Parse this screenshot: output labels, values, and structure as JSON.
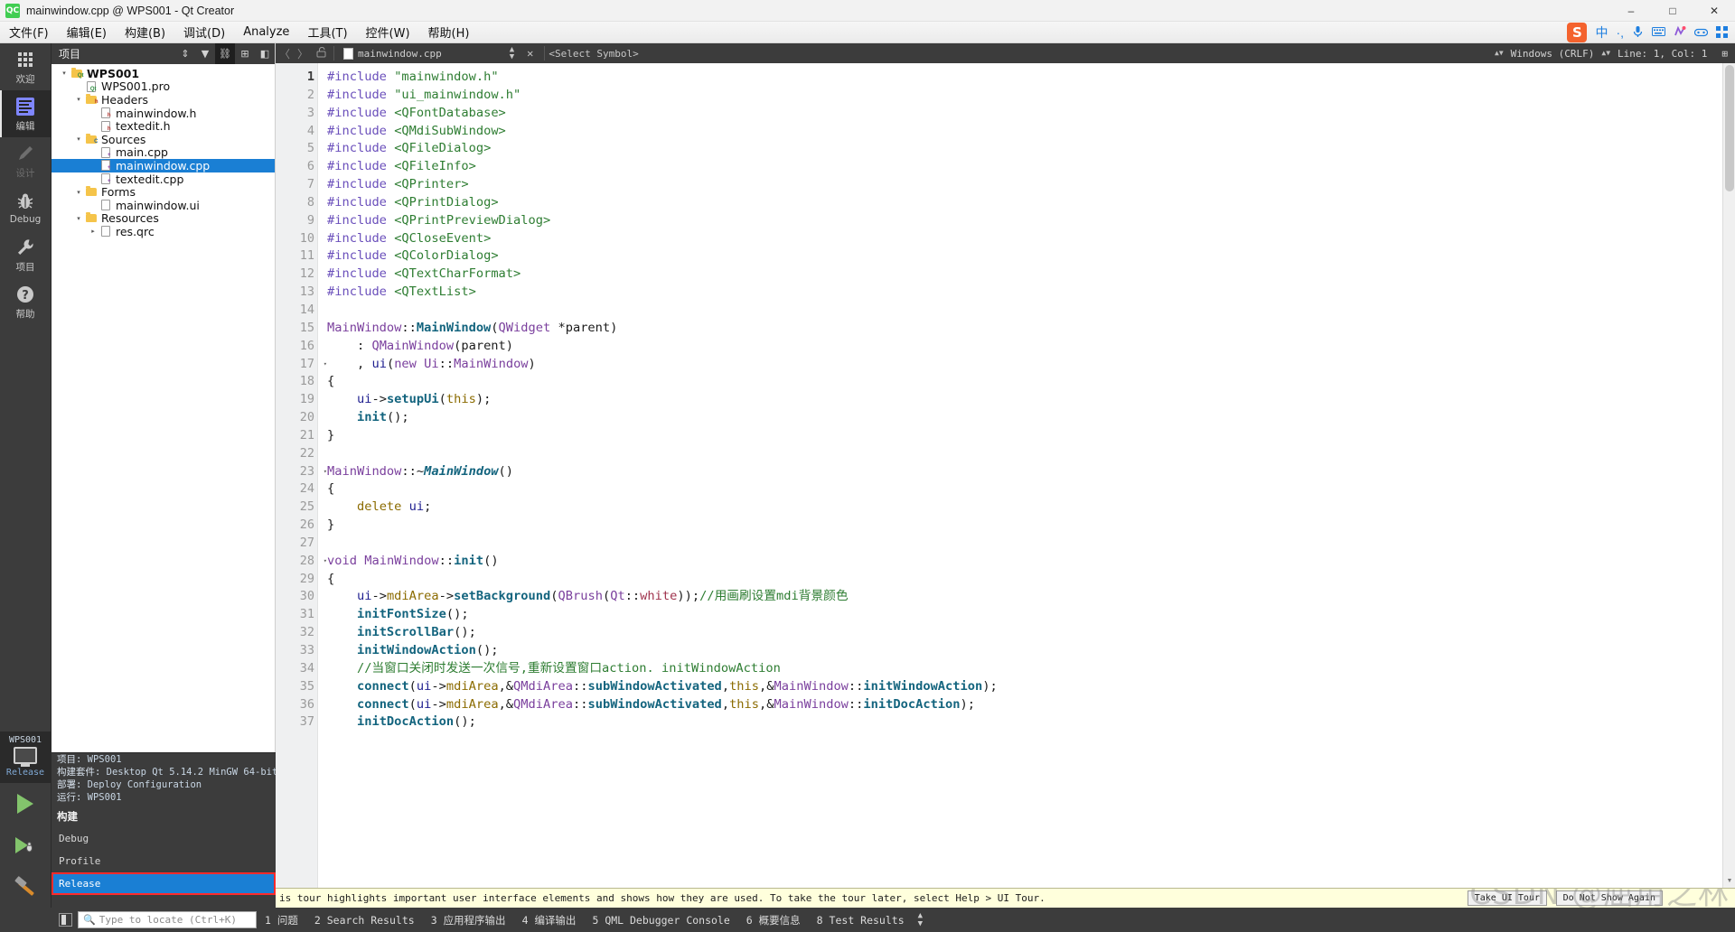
{
  "window": {
    "title": "mainwindow.cpp @ WPS001 - Qt Creator",
    "logo_text": "QC",
    "minimize": "–",
    "maximize": "□",
    "close": "✕"
  },
  "menubar": {
    "items": [
      {
        "label": "文件(F)",
        "name": "menu-file"
      },
      {
        "label": "编辑(E)",
        "name": "menu-edit"
      },
      {
        "label": "构建(B)",
        "name": "menu-build"
      },
      {
        "label": "调试(D)",
        "name": "menu-debug"
      },
      {
        "label": "Analyze",
        "name": "menu-analyze"
      },
      {
        "label": "工具(T)",
        "name": "menu-tools"
      },
      {
        "label": "控件(W)",
        "name": "menu-window"
      },
      {
        "label": "帮助(H)",
        "name": "menu-help"
      }
    ]
  },
  "ime_toolbar": {
    "logo": "S",
    "icons": [
      "中",
      "·,",
      "🎤",
      "⌨",
      "🎩",
      "🎮",
      "⊞"
    ]
  },
  "modebar": {
    "items": [
      {
        "label": "欢迎",
        "icon": "grid-icon",
        "state": "normal"
      },
      {
        "label": "编辑",
        "icon": "edit-icon",
        "state": "active"
      },
      {
        "label": "设计",
        "icon": "pencil-icon",
        "state": "disabled"
      },
      {
        "label": "Debug",
        "icon": "bug-icon",
        "state": "normal"
      },
      {
        "label": "项目",
        "icon": "wrench-icon",
        "state": "normal"
      },
      {
        "label": "帮助",
        "icon": "help-icon",
        "state": "normal"
      }
    ],
    "kit": {
      "project": "WPS001",
      "config": "Release"
    },
    "run_label": "run",
    "debug_label": "debug",
    "build_label": "build"
  },
  "sidebar": {
    "header": {
      "title": "项目",
      "tools": [
        "⇕",
        "▼",
        "⛓",
        "⊞",
        "◧"
      ]
    },
    "tree": [
      {
        "depth": 0,
        "label": "WPS001",
        "icon": "folder-qt",
        "arrow": "▾",
        "bold": true,
        "selected": false
      },
      {
        "depth": 1,
        "label": "WPS001.pro",
        "icon": "file-pro",
        "arrow": "",
        "bold": false,
        "selected": false
      },
      {
        "depth": 1,
        "label": "Headers",
        "icon": "folder-h",
        "arrow": "▾",
        "bold": false,
        "selected": false
      },
      {
        "depth": 2,
        "label": "mainwindow.h",
        "icon": "file-h",
        "arrow": "",
        "bold": false,
        "selected": false
      },
      {
        "depth": 2,
        "label": "textedit.h",
        "icon": "file-h",
        "arrow": "",
        "bold": false,
        "selected": false
      },
      {
        "depth": 1,
        "label": "Sources",
        "icon": "folder-cpp",
        "arrow": "▾",
        "bold": false,
        "selected": false
      },
      {
        "depth": 2,
        "label": "main.cpp",
        "icon": "file-cpp",
        "arrow": "",
        "bold": false,
        "selected": false
      },
      {
        "depth": 2,
        "label": "mainwindow.cpp",
        "icon": "file-cpp",
        "arrow": "",
        "bold": false,
        "selected": true
      },
      {
        "depth": 2,
        "label": "textedit.cpp",
        "icon": "file-cpp",
        "arrow": "",
        "bold": false,
        "selected": false
      },
      {
        "depth": 1,
        "label": "Forms",
        "icon": "folder-ui",
        "arrow": "▾",
        "bold": false,
        "selected": false
      },
      {
        "depth": 2,
        "label": "mainwindow.ui",
        "icon": "file-ui",
        "arrow": "",
        "bold": false,
        "selected": false
      },
      {
        "depth": 1,
        "label": "Resources",
        "icon": "folder-res",
        "arrow": "▾",
        "bold": false,
        "selected": false
      },
      {
        "depth": 2,
        "label": "res.qrc",
        "icon": "file-qrc",
        "arrow": "▸",
        "bold": false,
        "selected": false
      }
    ]
  },
  "build_popup": {
    "info": [
      {
        "key": "项目:",
        "value": "WPS001"
      },
      {
        "key": "构建套件:",
        "value": "Desktop Qt 5.14.2 MinGW 64-bit"
      },
      {
        "key": "部署:",
        "value": "Deploy Configuration"
      },
      {
        "key": "运行:",
        "value": "WPS001"
      }
    ],
    "section": "构建",
    "options": [
      {
        "label": "Debug",
        "selected": false
      },
      {
        "label": "Profile",
        "selected": false
      },
      {
        "label": "Release",
        "selected": true
      }
    ],
    "highlight_color": "#ff2b2b",
    "selection_color": "#1a7fd4"
  },
  "editor_toolbar": {
    "back": "〈",
    "forward": "〉",
    "lock_icon": "🔓",
    "filename": "mainwindow.cpp",
    "close_label": "✕",
    "symbol_selector": "<Select Symbol>",
    "line_ending": "Windows (CRLF)",
    "cursor": "Line: 1, Col: 1",
    "split_label": "⊞"
  },
  "code": {
    "first_line": 1,
    "lines": [
      {
        "n": 1,
        "fold": "",
        "tokens": [
          [
            "t-pre",
            "#include"
          ],
          [
            "t-plain",
            " "
          ],
          [
            "t-str",
            "\"mainwindow.h\""
          ]
        ]
      },
      {
        "n": 2,
        "fold": "",
        "tokens": [
          [
            "t-pre",
            "#include"
          ],
          [
            "t-plain",
            " "
          ],
          [
            "t-str",
            "\"ui_mainwindow.h\""
          ]
        ]
      },
      {
        "n": 3,
        "fold": "",
        "tokens": [
          [
            "t-pre",
            "#include"
          ],
          [
            "t-plain",
            " "
          ],
          [
            "t-inc",
            "<QFontDatabase>"
          ]
        ]
      },
      {
        "n": 4,
        "fold": "",
        "tokens": [
          [
            "t-pre",
            "#include"
          ],
          [
            "t-plain",
            " "
          ],
          [
            "t-inc",
            "<QMdiSubWindow>"
          ]
        ]
      },
      {
        "n": 5,
        "fold": "",
        "tokens": [
          [
            "t-pre",
            "#include"
          ],
          [
            "t-plain",
            " "
          ],
          [
            "t-inc",
            "<QFileDialog>"
          ]
        ]
      },
      {
        "n": 6,
        "fold": "",
        "tokens": [
          [
            "t-pre",
            "#include"
          ],
          [
            "t-plain",
            " "
          ],
          [
            "t-inc",
            "<QFileInfo>"
          ]
        ]
      },
      {
        "n": 7,
        "fold": "",
        "tokens": [
          [
            "t-pre",
            "#include"
          ],
          [
            "t-plain",
            " "
          ],
          [
            "t-inc",
            "<QPrinter>"
          ]
        ]
      },
      {
        "n": 8,
        "fold": "",
        "tokens": [
          [
            "t-pre",
            "#include"
          ],
          [
            "t-plain",
            " "
          ],
          [
            "t-inc",
            "<QPrintDialog>"
          ]
        ]
      },
      {
        "n": 9,
        "fold": "",
        "tokens": [
          [
            "t-pre",
            "#include"
          ],
          [
            "t-plain",
            " "
          ],
          [
            "t-inc",
            "<QPrintPreviewDialog>"
          ]
        ]
      },
      {
        "n": 10,
        "fold": "",
        "tokens": [
          [
            "t-pre",
            "#include"
          ],
          [
            "t-plain",
            " "
          ],
          [
            "t-inc",
            "<QCloseEvent>"
          ]
        ]
      },
      {
        "n": 11,
        "fold": "",
        "tokens": [
          [
            "t-pre",
            "#include"
          ],
          [
            "t-plain",
            " "
          ],
          [
            "t-inc",
            "<QColorDialog>"
          ]
        ]
      },
      {
        "n": 12,
        "fold": "",
        "tokens": [
          [
            "t-pre",
            "#include"
          ],
          [
            "t-plain",
            " "
          ],
          [
            "t-inc",
            "<QTextCharFormat>"
          ]
        ]
      },
      {
        "n": 13,
        "fold": "",
        "tokens": [
          [
            "t-pre",
            "#include"
          ],
          [
            "t-plain",
            " "
          ],
          [
            "t-inc",
            "<QTextList>"
          ]
        ]
      },
      {
        "n": 14,
        "fold": "",
        "tokens": []
      },
      {
        "n": 15,
        "fold": "",
        "tokens": [
          [
            "t-type",
            "MainWindow"
          ],
          [
            "t-plain",
            "::"
          ],
          [
            "t-fn",
            "MainWindow"
          ],
          [
            "t-plain",
            "("
          ],
          [
            "t-type",
            "QWidget"
          ],
          [
            "t-plain",
            " *parent)"
          ]
        ]
      },
      {
        "n": 16,
        "fold": "",
        "tokens": [
          [
            "t-plain",
            "    : "
          ],
          [
            "t-type",
            "QMainWindow"
          ],
          [
            "t-plain",
            "(parent)"
          ]
        ]
      },
      {
        "n": 17,
        "fold": "▾",
        "tokens": [
          [
            "t-plain",
            "    , "
          ],
          [
            "t-var",
            "ui"
          ],
          [
            "t-plain",
            "("
          ],
          [
            "t-kw",
            "new"
          ],
          [
            "t-plain",
            " "
          ],
          [
            "t-type",
            "Ui"
          ],
          [
            "t-plain",
            "::"
          ],
          [
            "t-type",
            "MainWindow"
          ],
          [
            "t-plain",
            ")"
          ]
        ]
      },
      {
        "n": 18,
        "fold": "",
        "tokens": [
          [
            "t-plain",
            "{"
          ]
        ]
      },
      {
        "n": 19,
        "fold": "",
        "tokens": [
          [
            "t-plain",
            "    "
          ],
          [
            "t-var",
            "ui"
          ],
          [
            "t-plain",
            "->"
          ],
          [
            "t-fn",
            "setupUi"
          ],
          [
            "t-plain",
            "("
          ],
          [
            "t-kw2",
            "this"
          ],
          [
            "t-plain",
            ");"
          ]
        ]
      },
      {
        "n": 20,
        "fold": "",
        "tokens": [
          [
            "t-plain",
            "    "
          ],
          [
            "t-fn",
            "init"
          ],
          [
            "t-plain",
            "();"
          ]
        ]
      },
      {
        "n": 21,
        "fold": "",
        "tokens": [
          [
            "t-plain",
            "}"
          ]
        ]
      },
      {
        "n": 22,
        "fold": "",
        "tokens": []
      },
      {
        "n": 23,
        "fold": "▾",
        "tokens": [
          [
            "t-type",
            "MainWindow"
          ],
          [
            "t-plain",
            "::~"
          ],
          [
            "t-fni",
            "MainWindow"
          ],
          [
            "t-plain",
            "()"
          ]
        ]
      },
      {
        "n": 24,
        "fold": "",
        "tokens": [
          [
            "t-plain",
            "{"
          ]
        ]
      },
      {
        "n": 25,
        "fold": "",
        "tokens": [
          [
            "t-plain",
            "    "
          ],
          [
            "t-kw2",
            "delete"
          ],
          [
            "t-plain",
            " "
          ],
          [
            "t-var",
            "ui"
          ],
          [
            "t-plain",
            ";"
          ]
        ]
      },
      {
        "n": 26,
        "fold": "",
        "tokens": [
          [
            "t-plain",
            "}"
          ]
        ]
      },
      {
        "n": 27,
        "fold": "",
        "tokens": []
      },
      {
        "n": 28,
        "fold": "▾",
        "tokens": [
          [
            "t-kw",
            "void"
          ],
          [
            "t-plain",
            " "
          ],
          [
            "t-type",
            "MainWindow"
          ],
          [
            "t-plain",
            "::"
          ],
          [
            "t-fn",
            "init"
          ],
          [
            "t-plain",
            "()"
          ]
        ]
      },
      {
        "n": 29,
        "fold": "",
        "tokens": [
          [
            "t-plain",
            "{"
          ]
        ]
      },
      {
        "n": 30,
        "fold": "",
        "tokens": [
          [
            "t-plain",
            "    "
          ],
          [
            "t-var",
            "ui"
          ],
          [
            "t-plain",
            "->"
          ],
          [
            "t-fld",
            "mdiArea"
          ],
          [
            "t-plain",
            "->"
          ],
          [
            "t-fn",
            "setBackground"
          ],
          [
            "t-plain",
            "("
          ],
          [
            "t-type",
            "QBrush"
          ],
          [
            "t-plain",
            "("
          ],
          [
            "t-type",
            "Qt"
          ],
          [
            "t-plain",
            "::"
          ],
          [
            "t-enum",
            "white"
          ],
          [
            "t-plain",
            "));"
          ],
          [
            "t-cmt",
            "//用画刷设置mdi背景颜色"
          ]
        ]
      },
      {
        "n": 31,
        "fold": "",
        "tokens": [
          [
            "t-plain",
            "    "
          ],
          [
            "t-fn",
            "initFontSize"
          ],
          [
            "t-plain",
            "();"
          ]
        ]
      },
      {
        "n": 32,
        "fold": "",
        "tokens": [
          [
            "t-plain",
            "    "
          ],
          [
            "t-fn",
            "initScrollBar"
          ],
          [
            "t-plain",
            "();"
          ]
        ]
      },
      {
        "n": 33,
        "fold": "",
        "tokens": [
          [
            "t-plain",
            "    "
          ],
          [
            "t-fn",
            "initWindowAction"
          ],
          [
            "t-plain",
            "();"
          ]
        ]
      },
      {
        "n": 34,
        "fold": "",
        "tokens": [
          [
            "t-cmt",
            "    //当窗口关闭时发送一次信号,重新设置窗口action. initWindowAction"
          ]
        ]
      },
      {
        "n": 35,
        "fold": "",
        "tokens": [
          [
            "t-plain",
            "    "
          ],
          [
            "t-fn",
            "connect"
          ],
          [
            "t-plain",
            "("
          ],
          [
            "t-var",
            "ui"
          ],
          [
            "t-plain",
            "->"
          ],
          [
            "t-fld",
            "mdiArea"
          ],
          [
            "t-plain",
            ",&"
          ],
          [
            "t-type",
            "QMdiArea"
          ],
          [
            "t-plain",
            "::"
          ],
          [
            "t-fn",
            "subWindowActivated"
          ],
          [
            "t-plain",
            ","
          ],
          [
            "t-kw2",
            "this"
          ],
          [
            "t-plain",
            ",&"
          ],
          [
            "t-type",
            "MainWindow"
          ],
          [
            "t-plain",
            "::"
          ],
          [
            "t-fn",
            "initWindowAction"
          ],
          [
            "t-plain",
            ");"
          ]
        ]
      },
      {
        "n": 36,
        "fold": "",
        "tokens": [
          [
            "t-plain",
            "    "
          ],
          [
            "t-fn",
            "connect"
          ],
          [
            "t-plain",
            "("
          ],
          [
            "t-var",
            "ui"
          ],
          [
            "t-plain",
            "->"
          ],
          [
            "t-fld",
            "mdiArea"
          ],
          [
            "t-plain",
            ",&"
          ],
          [
            "t-type",
            "QMdiArea"
          ],
          [
            "t-plain",
            "::"
          ],
          [
            "t-fn",
            "subWindowActivated"
          ],
          [
            "t-plain",
            ","
          ],
          [
            "t-kw2",
            "this"
          ],
          [
            "t-plain",
            ",&"
          ],
          [
            "t-type",
            "MainWindow"
          ],
          [
            "t-plain",
            "::"
          ],
          [
            "t-fn",
            "initDocAction"
          ],
          [
            "t-plain",
            ");"
          ]
        ]
      },
      {
        "n": 37,
        "fold": "",
        "tokens": [
          [
            "t-plain",
            "    "
          ],
          [
            "t-fn",
            "initDocAction"
          ],
          [
            "t-plain",
            "();"
          ]
        ]
      }
    ]
  },
  "tour": {
    "message": "is tour highlights important user interface elements and shows how they are used. To take the tour later, select Help > UI Tour.",
    "take_tour": "Take UI Tour",
    "dismiss": "Do Not Show Again",
    "watermark": "CSDN @屈用之林"
  },
  "statusbar": {
    "locate_placeholder": "Type to locate (Ctrl+K)",
    "panes": [
      {
        "num": "1",
        "label": "问题"
      },
      {
        "num": "2",
        "label": "Search Results"
      },
      {
        "num": "3",
        "label": "应用程序输出"
      },
      {
        "num": "4",
        "label": "编译输出"
      },
      {
        "num": "5",
        "label": "QML Debugger Console"
      },
      {
        "num": "6",
        "label": "概要信息"
      },
      {
        "num": "8",
        "label": "Test Results"
      }
    ]
  }
}
